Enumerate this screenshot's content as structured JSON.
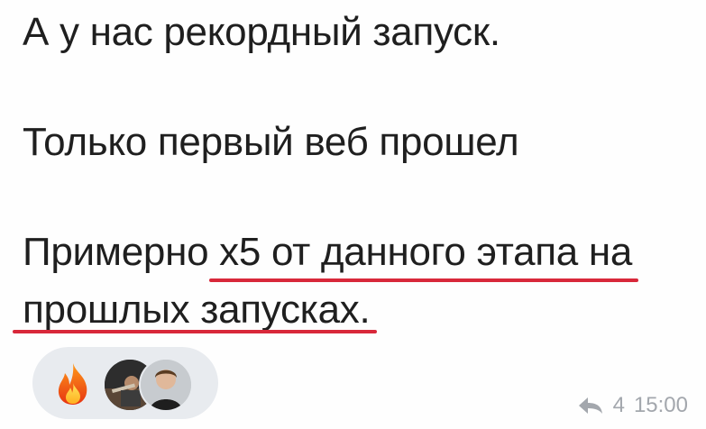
{
  "message": {
    "lines": [
      "А у нас рекордный запуск.",
      "Только первый веб прошел",
      "Примерно х5 от данного этапа на",
      "прошлых запусках."
    ],
    "reactions": {
      "emoji": "fire-icon",
      "reactor_avatars": [
        "avatar-1",
        "avatar-2"
      ]
    },
    "replies_count": "4",
    "time": "15:00"
  },
  "colors": {
    "underline": "#d8283a",
    "reaction_bg": "#e8ebef",
    "meta_text": "#a3a7ad"
  }
}
